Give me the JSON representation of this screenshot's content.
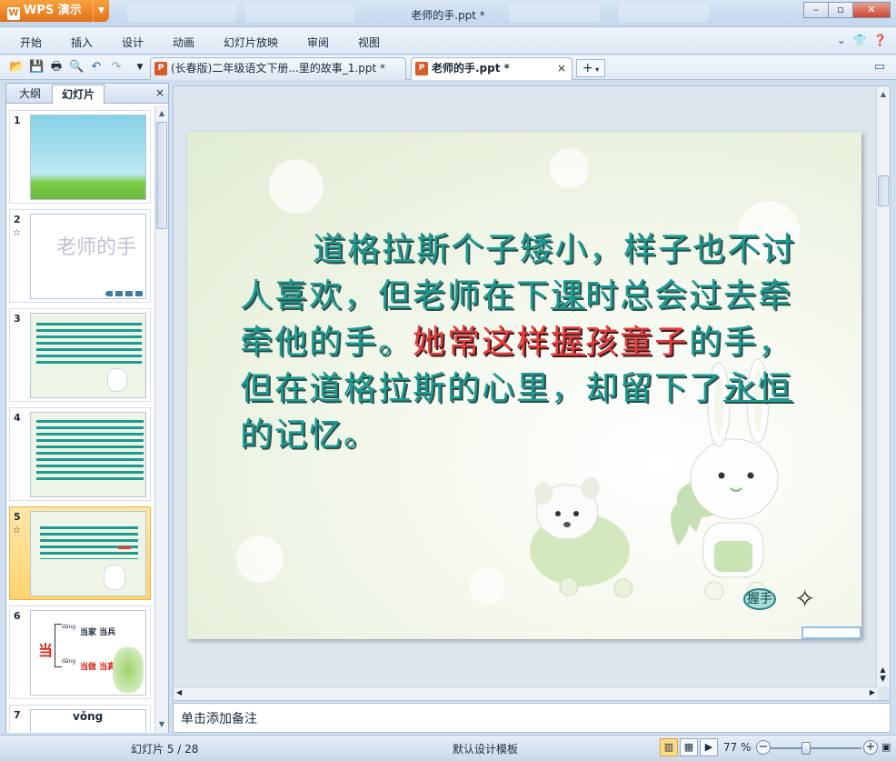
{
  "app": {
    "logo": "WPS 演示",
    "window_title": "老师的手.ppt *"
  },
  "window_buttons": {
    "minimize": "–",
    "restore": "▫",
    "close": "✕"
  },
  "menu": [
    "开始",
    "插入",
    "设计",
    "动画",
    "幻灯片放映",
    "审阅",
    "视图"
  ],
  "doc_tabs": [
    {
      "label": "(长春版)二年级语文下册...里的故事_1.ppt *",
      "active": false
    },
    {
      "label": "老师的手.ppt *",
      "active": true
    }
  ],
  "toolbar": {
    "new_tab": "+",
    "tab_close": "×"
  },
  "panel": {
    "tabs": [
      "大纲",
      "幻灯片"
    ],
    "close": "×"
  },
  "thumbnails": [
    {
      "num": "1",
      "star": ""
    },
    {
      "num": "2",
      "star": "☆",
      "text": "老师的手"
    },
    {
      "num": "3",
      "star": ""
    },
    {
      "num": "4",
      "star": ""
    },
    {
      "num": "5",
      "star": "☆"
    },
    {
      "num": "6",
      "star": ""
    },
    {
      "num": "7",
      "star": "",
      "text": "vǒng"
    }
  ],
  "thumb6": {
    "pinyin": "dāng",
    "w1": "当家 当兵",
    "w2": "当做 当真"
  },
  "slide": {
    "p1": "道格拉斯个子矮小，样子也不讨人喜欢，但老师在下",
    "u1": "课",
    "p2": "时总会过去牵牵他的手。",
    "red": "她常这样",
    "u2": "握",
    "red2": "孩童子",
    "p3": "的手，但在道格拉斯的心里，却留下了",
    "u3": "永恒",
    "p4": "的记忆。",
    "button": "握手"
  },
  "notes_placeholder": "单击添加备注",
  "status": {
    "slide_count": "幻灯片 5 / 28",
    "template": "默认设计模板",
    "zoom": "77 %"
  }
}
